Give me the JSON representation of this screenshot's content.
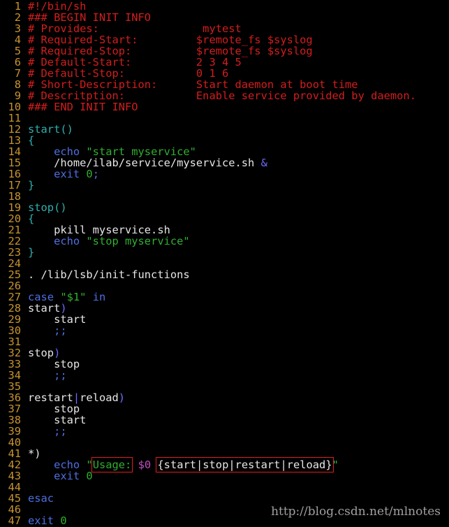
{
  "editor": {
    "lines": [
      [
        {
          "t": "#!/bin/sh",
          "c": "comment"
        }
      ],
      [
        {
          "t": "### BEGIN INIT INFO",
          "c": "comment"
        }
      ],
      [
        {
          "t": "# Provides:                mytest",
          "c": "comment"
        }
      ],
      [
        {
          "t": "# Required-Start:         $remote_fs $syslog",
          "c": "comment"
        }
      ],
      [
        {
          "t": "# Required-Stop:          $remote_fs $syslog",
          "c": "comment"
        }
      ],
      [
        {
          "t": "# Default-Start:          2 3 4 5",
          "c": "comment"
        }
      ],
      [
        {
          "t": "# Default-Stop:           0 1 6",
          "c": "comment"
        }
      ],
      [
        {
          "t": "# Short-Description:      Start daemon at boot time",
          "c": "comment"
        }
      ],
      [
        {
          "t": "# Descritption:           Enable service provided by daemon.",
          "c": "comment"
        }
      ],
      [
        {
          "t": "### END INIT INFO",
          "c": "comment"
        }
      ],
      [],
      [
        {
          "t": "start()",
          "c": "func"
        }
      ],
      [
        {
          "t": "{",
          "c": "func"
        }
      ],
      [
        {
          "t": "    echo ",
          "c": "keyword"
        },
        {
          "t": "\"start myservice\"",
          "c": "string"
        }
      ],
      [
        {
          "t": "    /home/ilab/service/myservice.sh ",
          "c": "text"
        },
        {
          "t": "&",
          "c": "op"
        }
      ],
      [
        {
          "t": "    exit ",
          "c": "keyword"
        },
        {
          "t": "0",
          "c": "num"
        },
        {
          "t": ";",
          "c": "keyword"
        }
      ],
      [
        {
          "t": "}",
          "c": "func"
        }
      ],
      [],
      [
        {
          "t": "stop()",
          "c": "func"
        }
      ],
      [
        {
          "t": "{",
          "c": "func"
        }
      ],
      [
        {
          "t": "    pkill myservice.sh",
          "c": "text"
        }
      ],
      [
        {
          "t": "    echo ",
          "c": "keyword"
        },
        {
          "t": "\"stop myservice\"",
          "c": "string"
        }
      ],
      [
        {
          "t": "}",
          "c": "func"
        }
      ],
      [],
      [
        {
          "t": ". /lib/lsb/init-functions",
          "c": "text"
        }
      ],
      [],
      [
        {
          "t": "case ",
          "c": "keyword"
        },
        {
          "t": "\"$1\"",
          "c": "string"
        },
        {
          "t": " in",
          "c": "keyword"
        }
      ],
      [
        {
          "t": "start",
          "c": "text"
        },
        {
          "t": ")",
          "c": "op"
        }
      ],
      [
        {
          "t": "    start",
          "c": "text"
        }
      ],
      [
        {
          "t": "    ;;",
          "c": "keyword"
        }
      ],
      [],
      [
        {
          "t": "stop",
          "c": "text"
        },
        {
          "t": ")",
          "c": "op"
        }
      ],
      [
        {
          "t": "    stop",
          "c": "text"
        }
      ],
      [
        {
          "t": "    ;;",
          "c": "keyword"
        }
      ],
      [],
      [
        {
          "t": "restart",
          "c": "text"
        },
        {
          "t": "|",
          "c": "op"
        },
        {
          "t": "reload",
          "c": "text"
        },
        {
          "t": ")",
          "c": "op"
        }
      ],
      [
        {
          "t": "    stop",
          "c": "text"
        }
      ],
      [
        {
          "t": "    start",
          "c": "text"
        }
      ],
      [
        {
          "t": "    ;;",
          "c": "keyword"
        }
      ],
      [],
      [
        {
          "t": "*)",
          "c": "text"
        }
      ],
      [
        {
          "t": "    echo ",
          "c": "keyword"
        },
        {
          "t": "\"",
          "c": "string"
        },
        {
          "t": "Usage:",
          "c": "string",
          "box": true
        },
        {
          "t": " ",
          "c": "string"
        },
        {
          "t": "$0",
          "c": "var"
        },
        {
          "t": " ",
          "c": "string"
        },
        {
          "t": "{start|stop|restart|reload}",
          "c": "text",
          "box": true
        },
        {
          "t": "\"",
          "c": "string"
        }
      ],
      [
        {
          "t": "    exit ",
          "c": "keyword"
        },
        {
          "t": "0",
          "c": "num"
        }
      ],
      [],
      [
        {
          "t": "esac",
          "c": "keyword"
        }
      ],
      [],
      [
        {
          "t": "exit ",
          "c": "keyword"
        },
        {
          "t": "0",
          "c": "num"
        }
      ]
    ]
  },
  "watermark": "http://blog.csdn.net/mlnotes"
}
